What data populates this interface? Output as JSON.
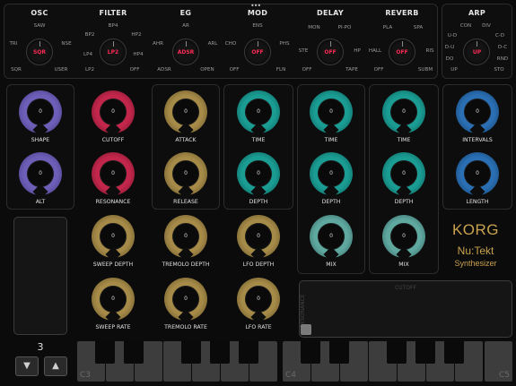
{
  "selectors": [
    {
      "id": "osc",
      "title": "OSC",
      "value": "SQR",
      "options": [
        "SAW",
        "TRI",
        "NSE",
        "SQR",
        "USER"
      ]
    },
    {
      "id": "filter",
      "title": "FILTER",
      "value": "LP2",
      "options": [
        "BP4",
        "BP2",
        "HP2",
        "LP4",
        "HP4",
        "LP2",
        "OFF"
      ]
    },
    {
      "id": "eg",
      "title": "EG",
      "value": "ADSR",
      "options": [
        "AR",
        "AHR",
        "ARL",
        "ADSR",
        "OPEN"
      ]
    },
    {
      "id": "mod",
      "title": "MOD",
      "value": "OFF",
      "options": [
        "ENS",
        "CHO",
        "PHS",
        "OFF",
        "FLN"
      ]
    },
    {
      "id": "delay",
      "title": "DELAY",
      "value": "OFF",
      "options": [
        "MON",
        "PI-PO",
        "STE",
        "HP",
        "OFF",
        "TAPE"
      ]
    },
    {
      "id": "reverb",
      "title": "REVERB",
      "value": "OFF",
      "options": [
        "PLA",
        "SPA",
        "HALL",
        "RIS",
        "OFF",
        "SUBM"
      ]
    },
    {
      "id": "arp",
      "title": "ARP",
      "value": "UP",
      "options": [
        "CON",
        "DIV",
        "U-D",
        "C-D",
        "D-U",
        "D-C",
        "DO",
        "RND",
        "UP",
        "STO"
      ]
    }
  ],
  "knobs": {
    "osc": [
      {
        "label": "SHAPE",
        "value": "0"
      },
      {
        "label": "ALT",
        "value": "0"
      }
    ],
    "filter": [
      {
        "label": "CUTOFF",
        "value": "0"
      },
      {
        "label": "RESONANCE",
        "value": "0"
      },
      {
        "label": "SWEEP DEPTH",
        "value": "0"
      },
      {
        "label": "SWEEP RATE",
        "value": "0"
      }
    ],
    "eg": [
      {
        "label": "ATTACK",
        "value": "0"
      },
      {
        "label": "RELEASE",
        "value": "0"
      },
      {
        "label": "TREMOLO DEPTH",
        "value": "0"
      },
      {
        "label": "TREMOLO RATE",
        "value": "0"
      }
    ],
    "mod": [
      {
        "label": "TIME",
        "value": "0"
      },
      {
        "label": "DEPTH",
        "value": "0"
      },
      {
        "label": "LFO DEPTH",
        "value": "0"
      },
      {
        "label": "LFO RATE",
        "value": "0"
      }
    ],
    "delay": [
      {
        "label": "TIME",
        "value": "0"
      },
      {
        "label": "DEPTH",
        "value": "0"
      },
      {
        "label": "MIX",
        "value": "0"
      }
    ],
    "reverb": [
      {
        "label": "TIME",
        "value": "0"
      },
      {
        "label": "DEPTH",
        "value": "0"
      },
      {
        "label": "MIX",
        "value": "0"
      }
    ],
    "arp": [
      {
        "label": "INTERVALS",
        "value": "0"
      },
      {
        "label": "LENGTH",
        "value": "0"
      }
    ]
  },
  "octave": {
    "value": "3",
    "down_icon": "triangle-down-icon",
    "up_icon": "triangle-up-icon"
  },
  "brand": {
    "line1": "KORG",
    "line2": "Nu:Tekt",
    "line3": "Synthesizer"
  },
  "xy_pad": {
    "x_label": "CUTOFF",
    "y_label": "RESONANCE"
  },
  "keyboard": {
    "labels": [
      "C3",
      "C4",
      "C5"
    ]
  },
  "colors": {
    "accent_red": "#ff2a55",
    "brand_gold": "#c9a24e",
    "purple": "#6d5fb8",
    "crimson": "#c2264b",
    "gold": "#a58a48",
    "teal": "#1a9c93",
    "blue": "#2a6fb4"
  }
}
